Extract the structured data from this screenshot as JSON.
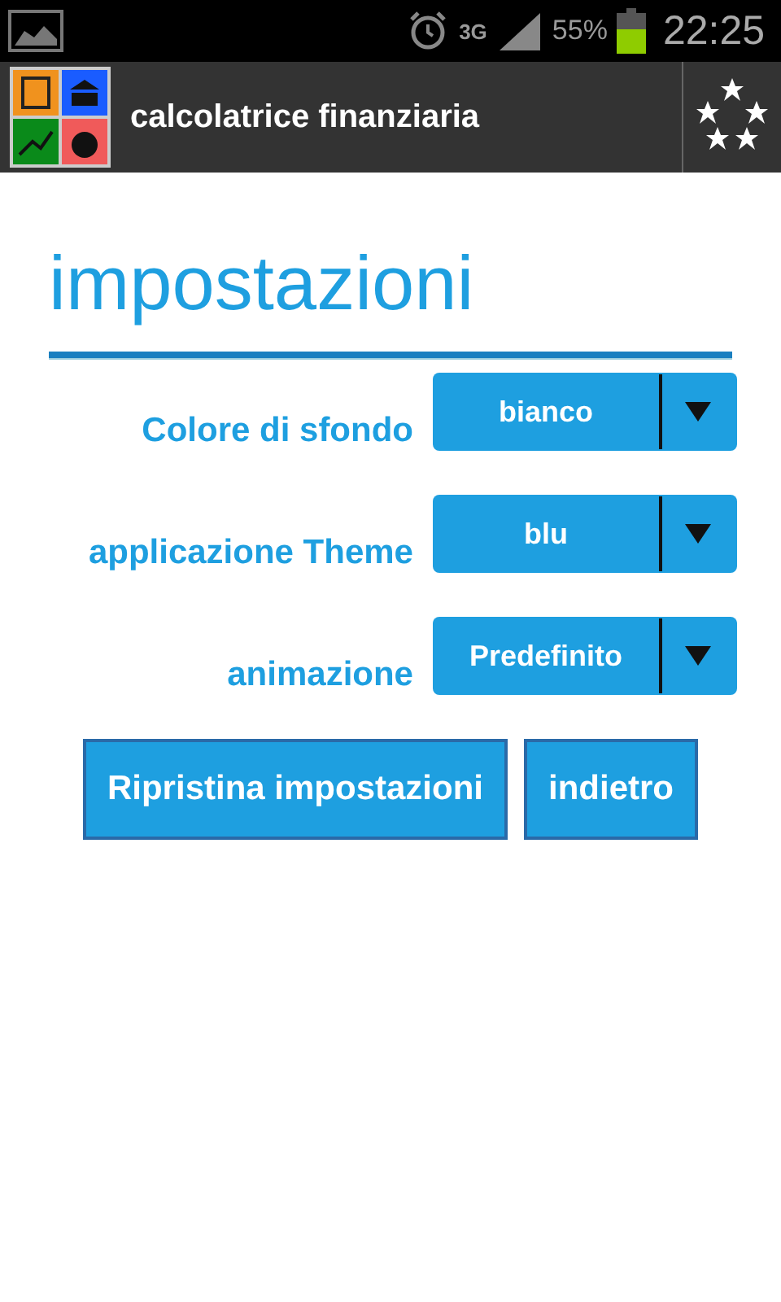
{
  "status_bar": {
    "battery": "55%",
    "time": "22:25",
    "network": "3G"
  },
  "app_bar": {
    "title": "calcolatrice finanziaria"
  },
  "page": {
    "heading": "impostazioni"
  },
  "settings": [
    {
      "label": "Colore di sfondo",
      "value": "bianco"
    },
    {
      "label": "applicazione Theme",
      "value": "blu"
    },
    {
      "label": "animazione",
      "value": "Predefinito"
    }
  ],
  "buttons": [
    {
      "label": "Ripristina impostazioni"
    },
    {
      "label": "indietro"
    }
  ]
}
